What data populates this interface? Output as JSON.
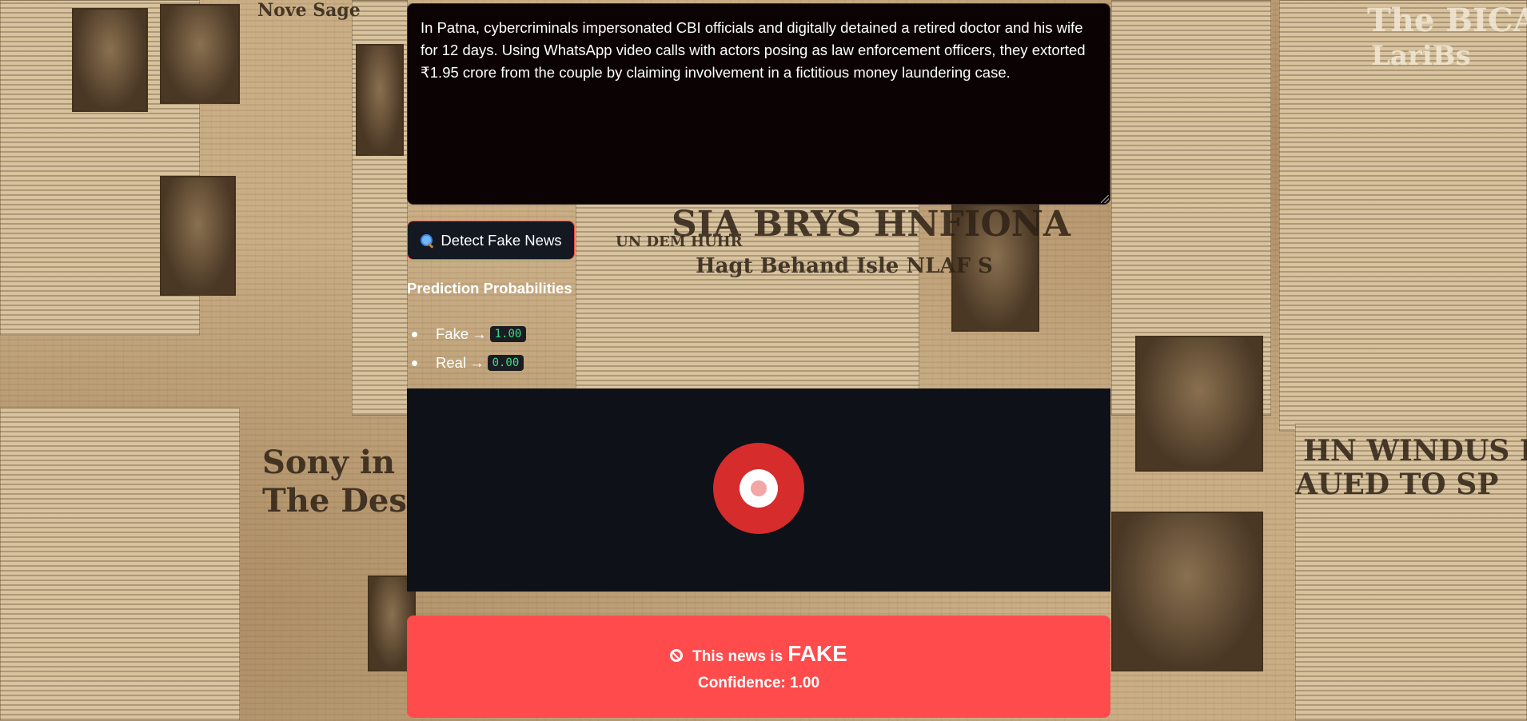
{
  "input": {
    "news_text": "In Patna, cybercriminals impersonated CBI officials and digitally detained a retired doctor and his wife for 12 days. Using WhatsApp video calls with actors posing as law enforcement officers, they extorted ₹1.95 crore from the couple by claiming involvement in a fictitious money laundering case."
  },
  "detect_button": {
    "icon": "magnifier-icon",
    "label": "Detect Fake News"
  },
  "probabilities": {
    "title": "Prediction Probabilities",
    "items": [
      {
        "label": "Fake",
        "arrow": "→",
        "value": "1.00"
      },
      {
        "label": "Real",
        "arrow": "→",
        "value": "0.00"
      }
    ]
  },
  "chart_data": {
    "type": "pie",
    "categories": [
      "Fake",
      "Real"
    ],
    "values": [
      1.0,
      0.0
    ],
    "colors": [
      "#d62c2c",
      "#f3a6a6"
    ],
    "hole": true
  },
  "result": {
    "icon": "ban-icon",
    "prefix": "This news is",
    "verdict": "FAKE",
    "confidence_text": "Confidence: 1.00",
    "color": "#ff4b4b"
  },
  "background": {
    "headlines": [
      "Nove Sage",
      "SIA BRYS HNFIONA",
      "Hagt Behand Isle NLAF S",
      "UN DEM HUHR",
      "The BICAD",
      "LariBs",
      "Sony in the",
      "The Descen",
      "HN WINDUS D",
      "AUED TO SP"
    ]
  }
}
